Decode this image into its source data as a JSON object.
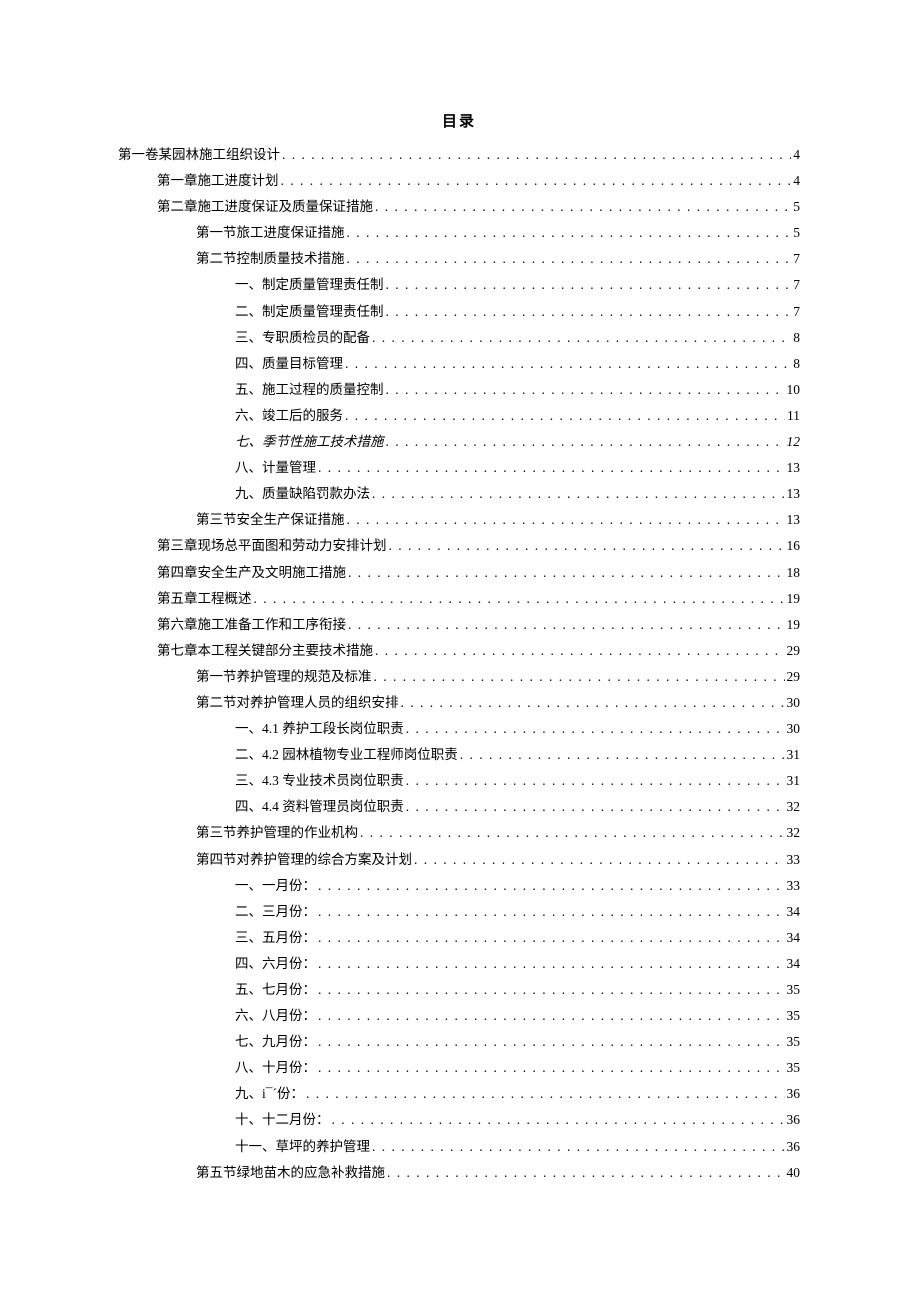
{
  "title": "目录",
  "toc": [
    {
      "label": "第一卷某园林施工组织设计",
      "page": "4",
      "level": 0
    },
    {
      "label": "第一章施工进度计划",
      "page": "4",
      "level": 1
    },
    {
      "label": "第二章施工进度保证及质量保证措施",
      "page": "5",
      "level": 1
    },
    {
      "label": "第一节旅工进度保证措施",
      "page": "5",
      "level": 2
    },
    {
      "label": "第二节控制质量技术措施",
      "page": "7",
      "level": 2
    },
    {
      "label": "一、制定质量管理责任制",
      "page": "7",
      "level": 3
    },
    {
      "label": "二、制定质量管理责任制",
      "page": "7",
      "level": 3
    },
    {
      "label": "三、专职质检员的配备",
      "page": "8",
      "level": 3
    },
    {
      "label": "四、质量目标管理",
      "page": "8",
      "level": 3
    },
    {
      "label": "五、施工过程的质量控制",
      "page": "10",
      "level": 3
    },
    {
      "label": "六、竣工后的服务",
      "page": "11",
      "level": 3
    },
    {
      "label": "七、季节性施工技术措施",
      "page": "12",
      "level": 3,
      "italic": true
    },
    {
      "label": "八、计量管理",
      "page": "13",
      "level": 3
    },
    {
      "label": "九、质量缺陷罚款办法",
      "page": "13",
      "level": 3
    },
    {
      "label": "第三节安全生产保证措施",
      "page": "13",
      "level": 2
    },
    {
      "label": "第三章现场总平面图和劳动力安排计划",
      "page": "16",
      "level": 1
    },
    {
      "label": "第四章安全生产及文明施工措施",
      "page": "18",
      "level": 1
    },
    {
      "label": "第五章工程概述",
      "page": "19",
      "level": 1
    },
    {
      "label": "第六章施工准备工作和工序衔接",
      "page": "19",
      "level": 1
    },
    {
      "label": "第七章本工程关键部分主要技术措施",
      "page": "29",
      "level": 1
    },
    {
      "label": "第一节养护管理的规范及标准",
      "page": "29",
      "level": 2
    },
    {
      "label": "第二节对养护管理人员的组织安排",
      "page": "30",
      "level": 2
    },
    {
      "label": "一、4.1 养护工段长岗位职责",
      "page": "30",
      "level": 3
    },
    {
      "label": "二、4.2 园林植物专业工程师岗位职责",
      "page": "31",
      "level": 3
    },
    {
      "label": "三、4.3 专业技术员岗位职责",
      "page": "31",
      "level": 3
    },
    {
      "label": "四、4.4 资料管理员岗位职责",
      "page": "32",
      "level": 3
    },
    {
      "label": "第三节养护管理的作业机构",
      "page": "32",
      "level": 2
    },
    {
      "label": "第四节对养护管理的综合方案及计划",
      "page": "33",
      "level": 2
    },
    {
      "label": "一、一月份：",
      "page": "33",
      "level": 3
    },
    {
      "label": "二、三月份：",
      "page": "34",
      "level": 3
    },
    {
      "label": "三、五月份：",
      "page": "34",
      "level": 3
    },
    {
      "label": "四、六月份：",
      "page": "34",
      "level": 3
    },
    {
      "label": "五、七月份：",
      "page": "35",
      "level": 3
    },
    {
      "label": "六、八月份：",
      "page": "35",
      "level": 3
    },
    {
      "label": "七、九月份：",
      "page": "35",
      "level": 3
    },
    {
      "label": "八、十月份：",
      "page": "35",
      "level": 3
    },
    {
      "label": "九、i¯´份：",
      "page": "36",
      "level": 3
    },
    {
      "label": "十、十二月份：",
      "page": "36",
      "level": 3
    },
    {
      "label": "十一、草坪的养护管理",
      "page": "36",
      "level": 3
    },
    {
      "label": "第五节绿地苗木的应急补救措施",
      "page": "40",
      "level": 2
    }
  ]
}
